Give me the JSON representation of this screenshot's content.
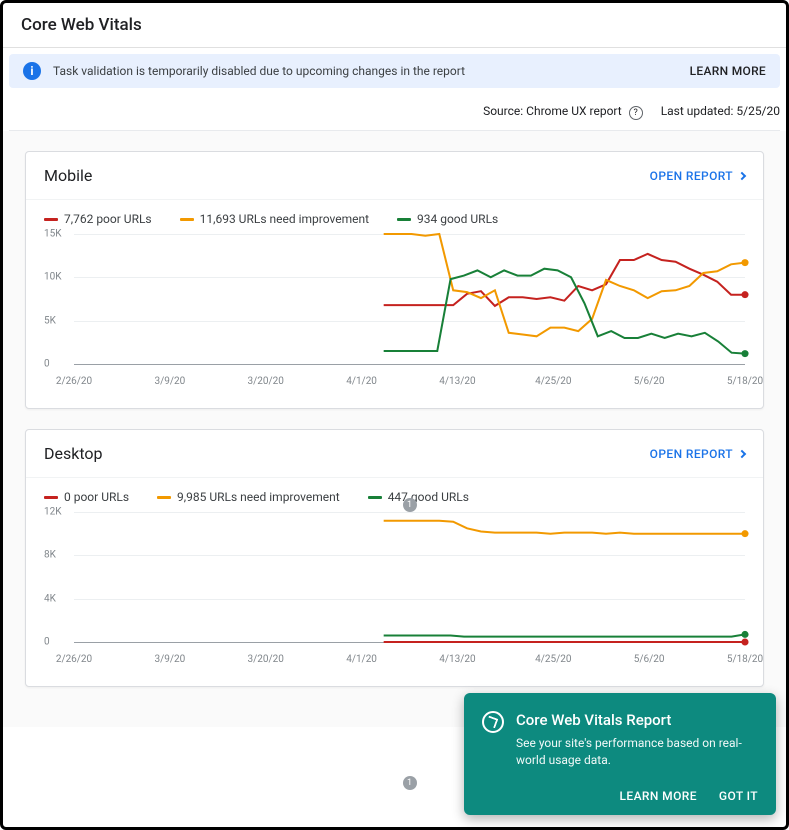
{
  "page_title": "Core Web Vitals",
  "banner": {
    "text": "Task validation is temporarily disabled due to upcoming changes in the report",
    "learn_more": "LEARN MORE"
  },
  "meta": {
    "source_label": "Source:",
    "source_value": "Chrome UX report",
    "updated_label": "Last updated:",
    "updated_value": "5/25/20"
  },
  "open_report_label": "OPEN REPORT",
  "colors": {
    "poor": "#c5221f",
    "needs": "#f29900",
    "good": "#188038"
  },
  "mobile": {
    "title": "Mobile",
    "legend": {
      "poor": "7,762 poor URLs",
      "needs": "11,693 URLs need improvement",
      "good": "934 good URLs"
    }
  },
  "desktop": {
    "title": "Desktop",
    "legend": {
      "poor": "0 poor URLs",
      "needs": "9,985 URLs need improvement",
      "good": "447 good URLs"
    }
  },
  "popup": {
    "title": "Core Web Vitals Report",
    "desc": "See your site's performance based on real-world usage data.",
    "learn_more": "LEARN MORE",
    "got_it": "GOT IT"
  },
  "chart_data": [
    {
      "type": "line",
      "title": "Mobile",
      "xlabel": "",
      "ylabel": "",
      "ylim": [
        0,
        15000
      ],
      "y_ticks": [
        0,
        5000,
        10000,
        15000
      ],
      "y_tick_labels": [
        "0",
        "5K",
        "10K",
        "15K"
      ],
      "x_tick_labels": [
        "2/26/20",
        "3/9/20",
        "3/20/20",
        "4/1/20",
        "4/13/20",
        "4/25/20",
        "5/6/20",
        "5/18/20"
      ],
      "annotation_index": 7,
      "series": [
        {
          "name": "poor",
          "color": "#c5221f",
          "values": [
            6800,
            6800,
            6800,
            6800,
            6800,
            6800,
            8100,
            8400,
            6700,
            7700,
            7700,
            7500,
            7700,
            7300,
            9000,
            8500,
            9200,
            12000,
            12000,
            12700,
            12000,
            11800,
            11000,
            10300,
            9500,
            8000,
            8000
          ]
        },
        {
          "name": "needs",
          "color": "#f29900",
          "values": [
            15000,
            15000,
            15000,
            14800,
            15000,
            8500,
            8300,
            7600,
            8500,
            3600,
            3400,
            3200,
            4200,
            4200,
            3800,
            5200,
            9700,
            9000,
            8500,
            7600,
            8400,
            8500,
            9000,
            10500,
            10700,
            11500,
            11700
          ]
        },
        {
          "name": "good",
          "color": "#188038",
          "values": [
            1500,
            1500,
            1500,
            1500,
            1500,
            9800,
            10200,
            10800,
            10000,
            10800,
            10200,
            10200,
            11000,
            10800,
            10000,
            7000,
            3200,
            3800,
            3000,
            3000,
            3500,
            3000,
            3500,
            3200,
            3600,
            2600,
            1300,
            1200
          ]
        }
      ]
    },
    {
      "type": "line",
      "title": "Desktop",
      "xlabel": "",
      "ylabel": "",
      "ylim": [
        0,
        12000
      ],
      "y_ticks": [
        0,
        4000,
        8000,
        12000
      ],
      "y_tick_labels": [
        "0",
        "4K",
        "8K",
        "12K"
      ],
      "x_tick_labels": [
        "2/26/20",
        "3/9/20",
        "3/20/20",
        "4/1/20",
        "4/13/20",
        "4/25/20",
        "5/6/20",
        "5/18/20"
      ],
      "annotation_index": 7,
      "series": [
        {
          "name": "poor",
          "color": "#c5221f",
          "values": [
            0,
            0,
            0,
            0,
            0,
            0,
            0,
            0,
            0,
            0,
            0,
            0,
            0,
            0,
            0,
            0,
            0,
            0,
            0,
            0,
            0,
            0,
            0,
            0,
            0,
            0,
            0
          ]
        },
        {
          "name": "needs",
          "color": "#f29900",
          "values": [
            11200,
            11200,
            11200,
            11200,
            11200,
            11100,
            10500,
            10200,
            10100,
            10100,
            10100,
            10100,
            10000,
            10100,
            10100,
            10100,
            10000,
            10100,
            10000,
            10000,
            10000,
            10000,
            10000,
            10000,
            10000,
            10000,
            10000
          ]
        },
        {
          "name": "good",
          "color": "#188038",
          "values": [
            600,
            600,
            600,
            600,
            600,
            600,
            500,
            500,
            500,
            500,
            500,
            500,
            500,
            500,
            500,
            500,
            500,
            500,
            500,
            500,
            500,
            500,
            500,
            500,
            500,
            500,
            500,
            700
          ]
        }
      ]
    }
  ]
}
